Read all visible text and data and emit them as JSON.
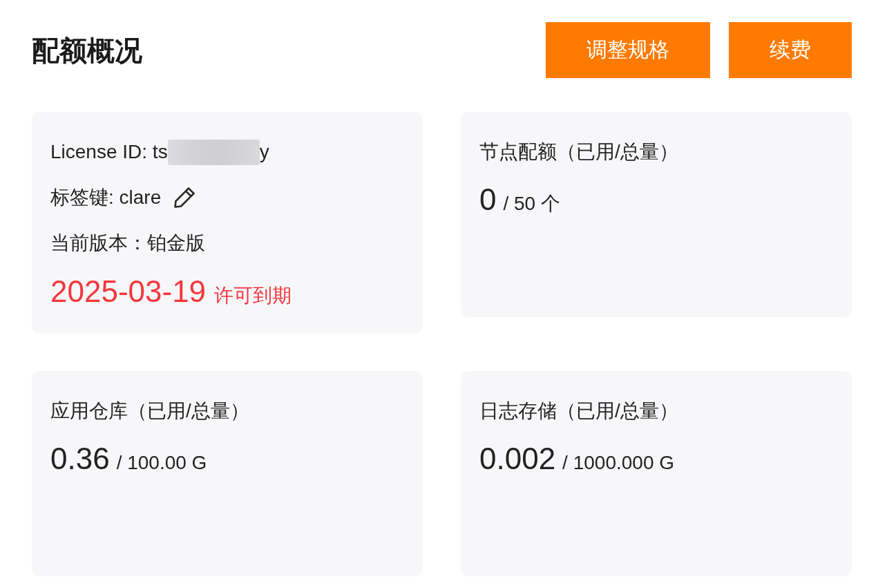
{
  "page": {
    "title": "配额概况"
  },
  "buttons": [
    {
      "label": "调整规格"
    },
    {
      "label": "续费"
    }
  ],
  "cards": [
    {
      "kind": "license",
      "license_id": {
        "prefix": "License ID: ts",
        "redacted": true,
        "suffix": "y"
      },
      "tag_key": {
        "text": "标签键: clare",
        "editable": true
      },
      "edition": "当前版本：铂金版",
      "expiry": {
        "date": "2025-03-19",
        "label": "许可到期"
      }
    },
    {
      "kind": "quota",
      "title": "节点配额（已用/总量）",
      "used": "0",
      "total": "/ 50 个"
    },
    {
      "kind": "quota",
      "title": "应用仓库（已用/总量）",
      "used": "0.36",
      "total": "/ 100.00 G"
    },
    {
      "kind": "quota",
      "title": "日志存储（已用/总量）",
      "used": "0.002",
      "total": "/ 1000.000 G"
    }
  ]
}
